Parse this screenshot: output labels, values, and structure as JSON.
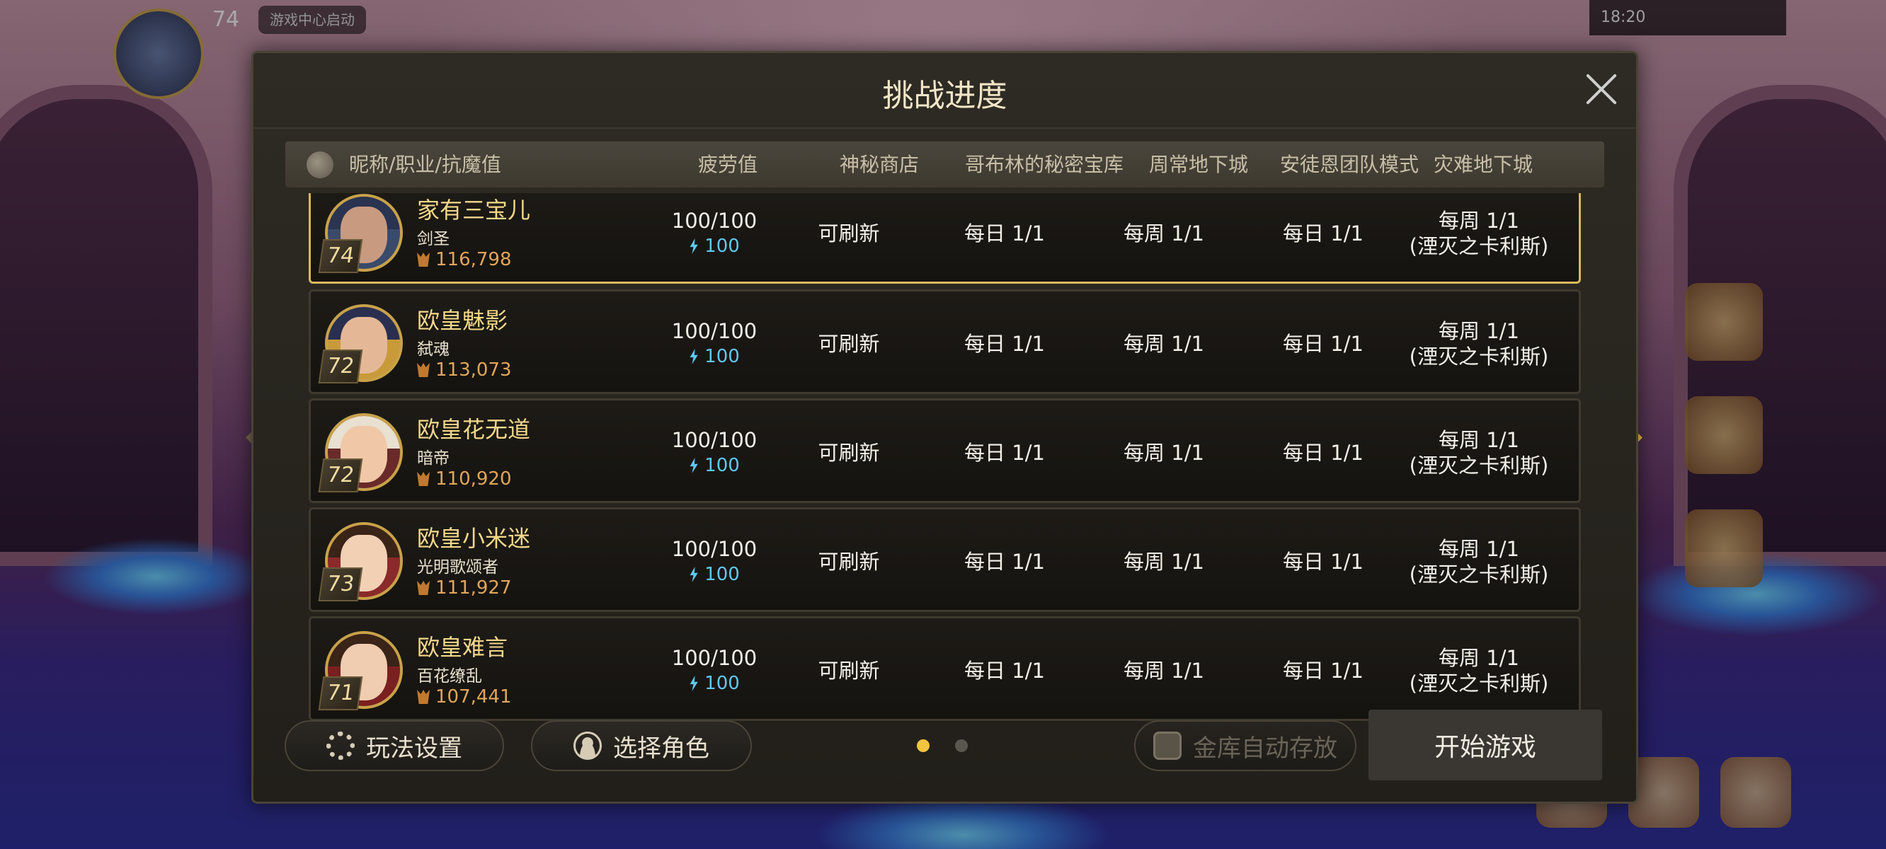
{
  "hud": {
    "level": "74",
    "game_center_label": "游戏中心启动",
    "status_time": "18:20"
  },
  "dialog": {
    "title": "挑战进度",
    "columns": {
      "name": "昵称/职业/抗魔值",
      "fatigue": "疲劳值",
      "shop": "神秘商店",
      "goblin": "哥布林的秘密宝库",
      "weekly": "周常地下城",
      "antoine": "安徒恩团队模式",
      "calamity": "灾难地下城"
    },
    "rows": [
      {
        "name": "家有三宝儿",
        "class": "剑圣",
        "level": "74",
        "power": "116,798",
        "fatigue": "100/100",
        "fatigue_sub": "100",
        "shop": "可刷新",
        "goblin": "每日 1/1",
        "weekly": "每周 1/1",
        "antoine": "每日 1/1",
        "calamity_1": "每周 1/1",
        "calamity_2": "(湮灭之卡利斯)"
      },
      {
        "name": "欧皇魅影",
        "class": "弑魂",
        "level": "72",
        "power": "113,073",
        "fatigue": "100/100",
        "fatigue_sub": "100",
        "shop": "可刷新",
        "goblin": "每日 1/1",
        "weekly": "每周 1/1",
        "antoine": "每日 1/1",
        "calamity_1": "每周 1/1",
        "calamity_2": "(湮灭之卡利斯)"
      },
      {
        "name": "欧皇花无道",
        "class": "暗帝",
        "level": "72",
        "power": "110,920",
        "fatigue": "100/100",
        "fatigue_sub": "100",
        "shop": "可刷新",
        "goblin": "每日 1/1",
        "weekly": "每周 1/1",
        "antoine": "每日 1/1",
        "calamity_1": "每周 1/1",
        "calamity_2": "(湮灭之卡利斯)"
      },
      {
        "name": "欧皇小米迷",
        "class": "光明歌颂者",
        "level": "73",
        "power": "111,927",
        "fatigue": "100/100",
        "fatigue_sub": "100",
        "shop": "可刷新",
        "goblin": "每日 1/1",
        "weekly": "每周 1/1",
        "antoine": "每日 1/1",
        "calamity_1": "每周 1/1",
        "calamity_2": "(湮灭之卡利斯)"
      },
      {
        "name": "欧皇难言",
        "class": "百花缭乱",
        "level": "71",
        "power": "107,441",
        "fatigue": "100/100",
        "fatigue_sub": "100",
        "shop": "可刷新",
        "goblin": "每日 1/1",
        "weekly": "每周 1/1",
        "antoine": "每日 1/1",
        "calamity_1": "每周 1/1",
        "calamity_2": "(湮灭之卡利斯)"
      }
    ]
  },
  "footer": {
    "settings_label": "玩法设置",
    "select_role_label": "选择角色",
    "vault_label": "金库自动存放",
    "start_label": "开始游戏",
    "page_indicator": {
      "current": 1,
      "total": 2
    }
  },
  "colors": {
    "accent_gold": "#d9b85f",
    "fatigue_blue": "#5fc8f0",
    "power_orange": "#e0a65a",
    "dot_active": "#f2c440",
    "dot_inactive": "#5a5650"
  }
}
